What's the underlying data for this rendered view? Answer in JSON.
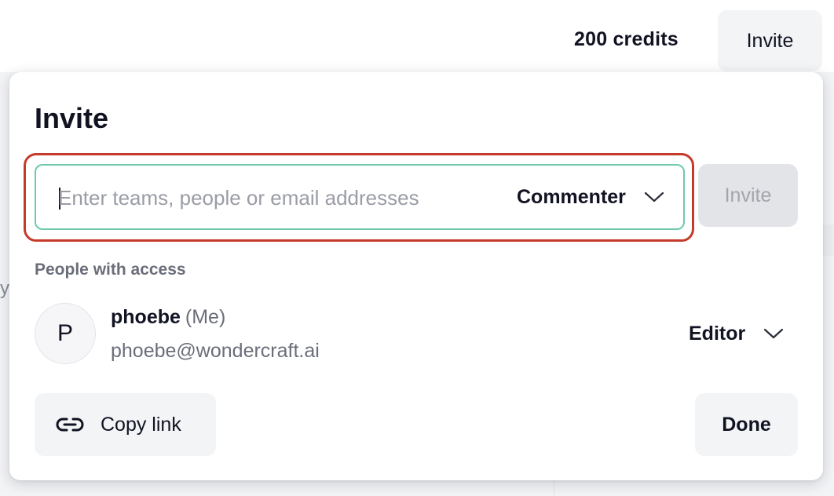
{
  "header": {
    "credits": "200 credits",
    "invite_label": "Invite"
  },
  "background": {
    "fragment": "y"
  },
  "modal": {
    "title": "Invite",
    "search": {
      "placeholder": "Enter teams, people or email addresses",
      "value": ""
    },
    "role_select": {
      "selected": "Commenter"
    },
    "invite_button": "Invite",
    "section_label": "People with access",
    "people": [
      {
        "initial": "P",
        "name": "phoebe",
        "tag": "(Me)",
        "email": "phoebe@wondercraft.ai",
        "role": "Editor"
      }
    ],
    "copy_link_label": "Copy link",
    "done_label": "Done"
  },
  "colors": {
    "highlight": "#c63a2b",
    "input_border": "#6fc9ac",
    "text": "#111322",
    "muted": "#6b6e7a"
  },
  "icons": {
    "chevron": "chevron-down-icon",
    "link": "link-icon"
  }
}
